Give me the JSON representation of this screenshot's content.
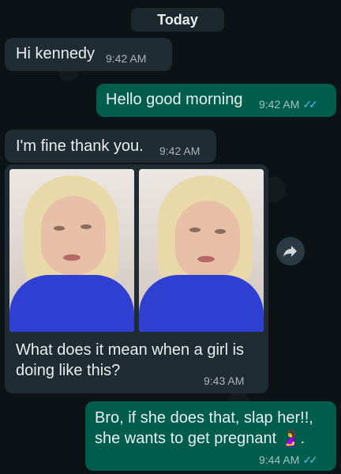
{
  "day_divider": "Today",
  "messages": [
    {
      "text": "Hi kennedy",
      "time": "9:42 AM",
      "direction": "incoming"
    },
    {
      "text": "Hello good morning",
      "time": "9:42 AM",
      "direction": "outgoing",
      "read": true
    },
    {
      "text": "I'm fine thank you.",
      "time": "9:42 AM",
      "direction": "incoming"
    },
    {
      "caption_line1": "What does it mean when a girl is",
      "caption_line2": "doing like this?",
      "time": "9:43 AM",
      "direction": "incoming",
      "has_image": true
    },
    {
      "line1": "Bro, if she does that, slap her!!,",
      "line2": "she wants to get pregnant 🤰.",
      "time": "9:44 AM",
      "direction": "outgoing",
      "read": true
    }
  ],
  "icons": {
    "forward": "forward-icon",
    "read_receipt": "double-check-icon"
  },
  "colors": {
    "incoming_bubble": "#1f2c33",
    "outgoing_bubble": "#005c4b",
    "read_tick": "#53bdeb",
    "background": "#0c1317"
  }
}
